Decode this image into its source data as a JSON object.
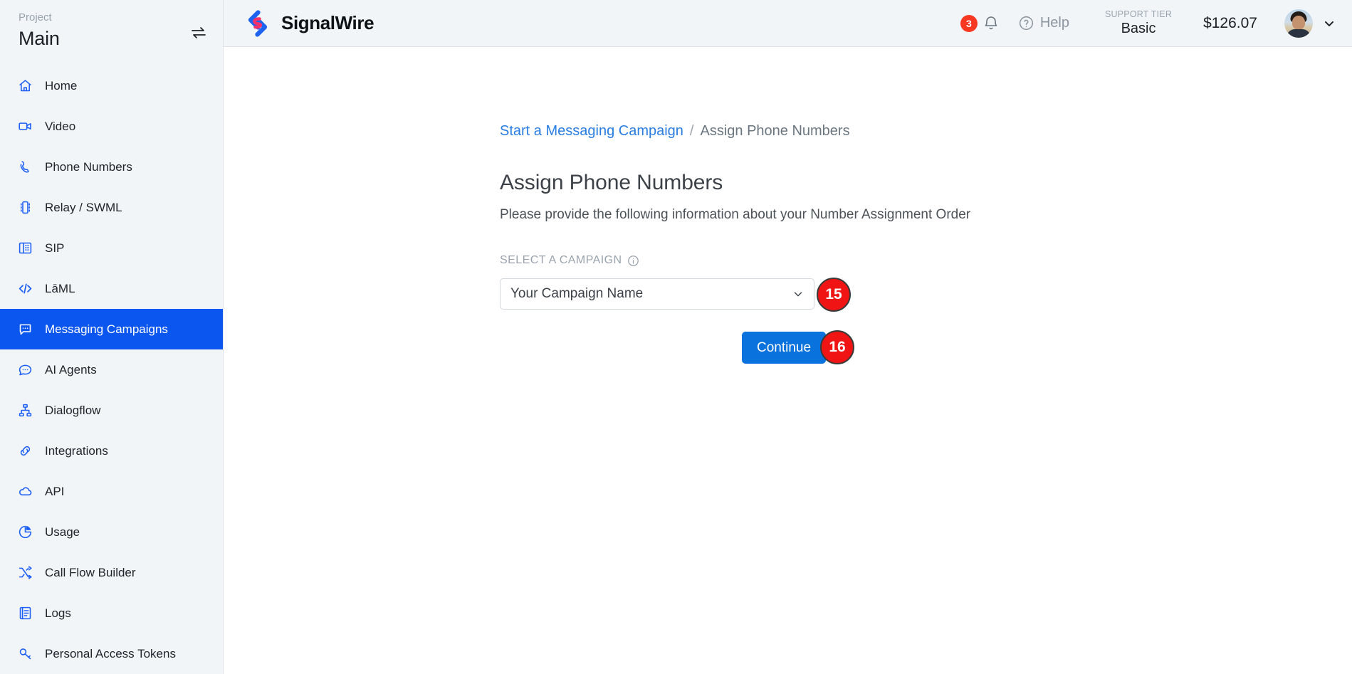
{
  "sidebar": {
    "project_label": "Project",
    "project_name": "Main",
    "switch_icon": "switch-project-icon",
    "items": [
      {
        "label": "Home",
        "icon": "home-icon",
        "active": false
      },
      {
        "label": "Video",
        "icon": "video-camera-icon",
        "active": false
      },
      {
        "label": "Phone Numbers",
        "icon": "phone-icon",
        "active": false
      },
      {
        "label": "Relay / SWML",
        "icon": "chip-icon",
        "active": false
      },
      {
        "label": "SIP",
        "icon": "desk-phone-icon",
        "active": false
      },
      {
        "label": "LāML",
        "icon": "code-brackets-icon",
        "active": false
      },
      {
        "label": "Messaging Campaigns",
        "icon": "chat-bubble-icon",
        "active": true
      },
      {
        "label": "AI Agents",
        "icon": "chat-dots-icon",
        "active": false
      },
      {
        "label": "Dialogflow",
        "icon": "sitemap-icon",
        "active": false
      },
      {
        "label": "Integrations",
        "icon": "link-chain-icon",
        "active": false
      },
      {
        "label": "API",
        "icon": "cloud-icon",
        "active": false
      },
      {
        "label": "Usage",
        "icon": "pie-chart-icon",
        "active": false
      },
      {
        "label": "Call Flow Builder",
        "icon": "shuffle-icon",
        "active": false
      },
      {
        "label": "Logs",
        "icon": "document-lines-icon",
        "active": false
      },
      {
        "label": "Personal Access Tokens",
        "icon": "key-icon",
        "active": false
      }
    ]
  },
  "topbar": {
    "brand_name": "SignalWire",
    "brand_logo_icon": "signalwire-logo-icon",
    "notification_count": "3",
    "bell_icon": "bell-icon",
    "help_label": "Help",
    "help_icon": "question-circle-icon",
    "support_tier_label": "SUPPORT TIER",
    "support_tier_value": "Basic",
    "balance": "$126.07",
    "avatar_icon": "user-avatar",
    "account_chevron_icon": "chevron-down-icon"
  },
  "breadcrumb": {
    "parent": "Start a Messaging Campaign",
    "separator": "/",
    "current": "Assign Phone Numbers"
  },
  "page": {
    "title": "Assign Phone Numbers",
    "subtitle": "Please provide the following information about your Number Assignment Order"
  },
  "form": {
    "campaign_label": "SELECT A CAMPAIGN",
    "campaign_info_icon": "info-icon",
    "campaign_value": "Your Campaign Name",
    "campaign_chevron_icon": "chevron-down-icon",
    "continue_label": "Continue"
  },
  "markers": {
    "select": "15",
    "continue": "16"
  },
  "colors": {
    "accent_blue": "#0b56ef",
    "button_blue": "#0a72dd",
    "link_blue": "#2a7de1",
    "icon_blue": "#1d5ff5",
    "marker_red": "#f01414",
    "notification_red": "#f93822",
    "sidebar_bg": "#f1f5f8",
    "logo_pink": "#f5316c"
  }
}
